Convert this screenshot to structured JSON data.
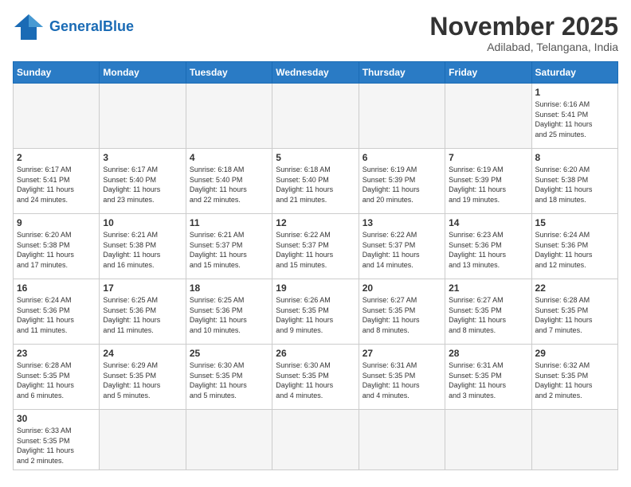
{
  "header": {
    "logo_general": "General",
    "logo_blue": "Blue",
    "month_title": "November 2025",
    "location": "Adilabad, Telangana, India"
  },
  "weekdays": [
    "Sunday",
    "Monday",
    "Tuesday",
    "Wednesday",
    "Thursday",
    "Friday",
    "Saturday"
  ],
  "weeks": [
    [
      {
        "day": "",
        "info": ""
      },
      {
        "day": "",
        "info": ""
      },
      {
        "day": "",
        "info": ""
      },
      {
        "day": "",
        "info": ""
      },
      {
        "day": "",
        "info": ""
      },
      {
        "day": "",
        "info": ""
      },
      {
        "day": "1",
        "info": "Sunrise: 6:16 AM\nSunset: 5:41 PM\nDaylight: 11 hours\nand 25 minutes."
      }
    ],
    [
      {
        "day": "2",
        "info": "Sunrise: 6:17 AM\nSunset: 5:41 PM\nDaylight: 11 hours\nand 24 minutes."
      },
      {
        "day": "3",
        "info": "Sunrise: 6:17 AM\nSunset: 5:40 PM\nDaylight: 11 hours\nand 23 minutes."
      },
      {
        "day": "4",
        "info": "Sunrise: 6:18 AM\nSunset: 5:40 PM\nDaylight: 11 hours\nand 22 minutes."
      },
      {
        "day": "5",
        "info": "Sunrise: 6:18 AM\nSunset: 5:40 PM\nDaylight: 11 hours\nand 21 minutes."
      },
      {
        "day": "6",
        "info": "Sunrise: 6:19 AM\nSunset: 5:39 PM\nDaylight: 11 hours\nand 20 minutes."
      },
      {
        "day": "7",
        "info": "Sunrise: 6:19 AM\nSunset: 5:39 PM\nDaylight: 11 hours\nand 19 minutes."
      },
      {
        "day": "8",
        "info": "Sunrise: 6:20 AM\nSunset: 5:38 PM\nDaylight: 11 hours\nand 18 minutes."
      }
    ],
    [
      {
        "day": "9",
        "info": "Sunrise: 6:20 AM\nSunset: 5:38 PM\nDaylight: 11 hours\nand 17 minutes."
      },
      {
        "day": "10",
        "info": "Sunrise: 6:21 AM\nSunset: 5:38 PM\nDaylight: 11 hours\nand 16 minutes."
      },
      {
        "day": "11",
        "info": "Sunrise: 6:21 AM\nSunset: 5:37 PM\nDaylight: 11 hours\nand 15 minutes."
      },
      {
        "day": "12",
        "info": "Sunrise: 6:22 AM\nSunset: 5:37 PM\nDaylight: 11 hours\nand 15 minutes."
      },
      {
        "day": "13",
        "info": "Sunrise: 6:22 AM\nSunset: 5:37 PM\nDaylight: 11 hours\nand 14 minutes."
      },
      {
        "day": "14",
        "info": "Sunrise: 6:23 AM\nSunset: 5:36 PM\nDaylight: 11 hours\nand 13 minutes."
      },
      {
        "day": "15",
        "info": "Sunrise: 6:24 AM\nSunset: 5:36 PM\nDaylight: 11 hours\nand 12 minutes."
      }
    ],
    [
      {
        "day": "16",
        "info": "Sunrise: 6:24 AM\nSunset: 5:36 PM\nDaylight: 11 hours\nand 11 minutes."
      },
      {
        "day": "17",
        "info": "Sunrise: 6:25 AM\nSunset: 5:36 PM\nDaylight: 11 hours\nand 11 minutes."
      },
      {
        "day": "18",
        "info": "Sunrise: 6:25 AM\nSunset: 5:36 PM\nDaylight: 11 hours\nand 10 minutes."
      },
      {
        "day": "19",
        "info": "Sunrise: 6:26 AM\nSunset: 5:35 PM\nDaylight: 11 hours\nand 9 minutes."
      },
      {
        "day": "20",
        "info": "Sunrise: 6:27 AM\nSunset: 5:35 PM\nDaylight: 11 hours\nand 8 minutes."
      },
      {
        "day": "21",
        "info": "Sunrise: 6:27 AM\nSunset: 5:35 PM\nDaylight: 11 hours\nand 8 minutes."
      },
      {
        "day": "22",
        "info": "Sunrise: 6:28 AM\nSunset: 5:35 PM\nDaylight: 11 hours\nand 7 minutes."
      }
    ],
    [
      {
        "day": "23",
        "info": "Sunrise: 6:28 AM\nSunset: 5:35 PM\nDaylight: 11 hours\nand 6 minutes."
      },
      {
        "day": "24",
        "info": "Sunrise: 6:29 AM\nSunset: 5:35 PM\nDaylight: 11 hours\nand 5 minutes."
      },
      {
        "day": "25",
        "info": "Sunrise: 6:30 AM\nSunset: 5:35 PM\nDaylight: 11 hours\nand 5 minutes."
      },
      {
        "day": "26",
        "info": "Sunrise: 6:30 AM\nSunset: 5:35 PM\nDaylight: 11 hours\nand 4 minutes."
      },
      {
        "day": "27",
        "info": "Sunrise: 6:31 AM\nSunset: 5:35 PM\nDaylight: 11 hours\nand 4 minutes."
      },
      {
        "day": "28",
        "info": "Sunrise: 6:31 AM\nSunset: 5:35 PM\nDaylight: 11 hours\nand 3 minutes."
      },
      {
        "day": "29",
        "info": "Sunrise: 6:32 AM\nSunset: 5:35 PM\nDaylight: 11 hours\nand 2 minutes."
      }
    ],
    [
      {
        "day": "30",
        "info": "Sunrise: 6:33 AM\nSunset: 5:35 PM\nDaylight: 11 hours\nand 2 minutes."
      },
      {
        "day": "",
        "info": ""
      },
      {
        "day": "",
        "info": ""
      },
      {
        "day": "",
        "info": ""
      },
      {
        "day": "",
        "info": ""
      },
      {
        "day": "",
        "info": ""
      },
      {
        "day": "",
        "info": ""
      }
    ]
  ]
}
